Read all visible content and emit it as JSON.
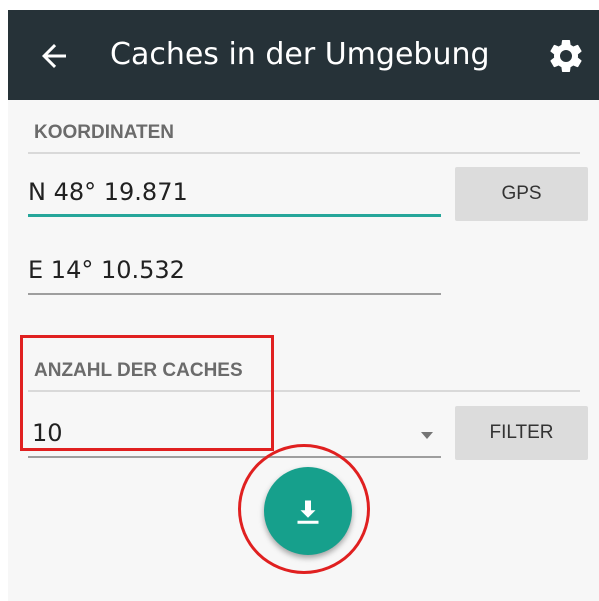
{
  "appbar": {
    "title": "Caches in der Umgebung",
    "back_icon": "arrow-left-icon",
    "settings_icon": "gear-icon",
    "background_color": "#263238"
  },
  "coordinates": {
    "header": "KOORDINATEN",
    "latitude": "N 48° 19.871",
    "longitude": "E 14° 10.532",
    "gps_button_label": "GPS"
  },
  "cache_count": {
    "header": "ANZAHL DER CACHES",
    "selected_value": "10",
    "filter_button_label": "FILTER"
  },
  "fab": {
    "icon": "download-icon",
    "color": "#16a08c"
  },
  "annotations": {
    "highlight_color": "#e02020"
  },
  "colors": {
    "accent": "#26a69a"
  }
}
